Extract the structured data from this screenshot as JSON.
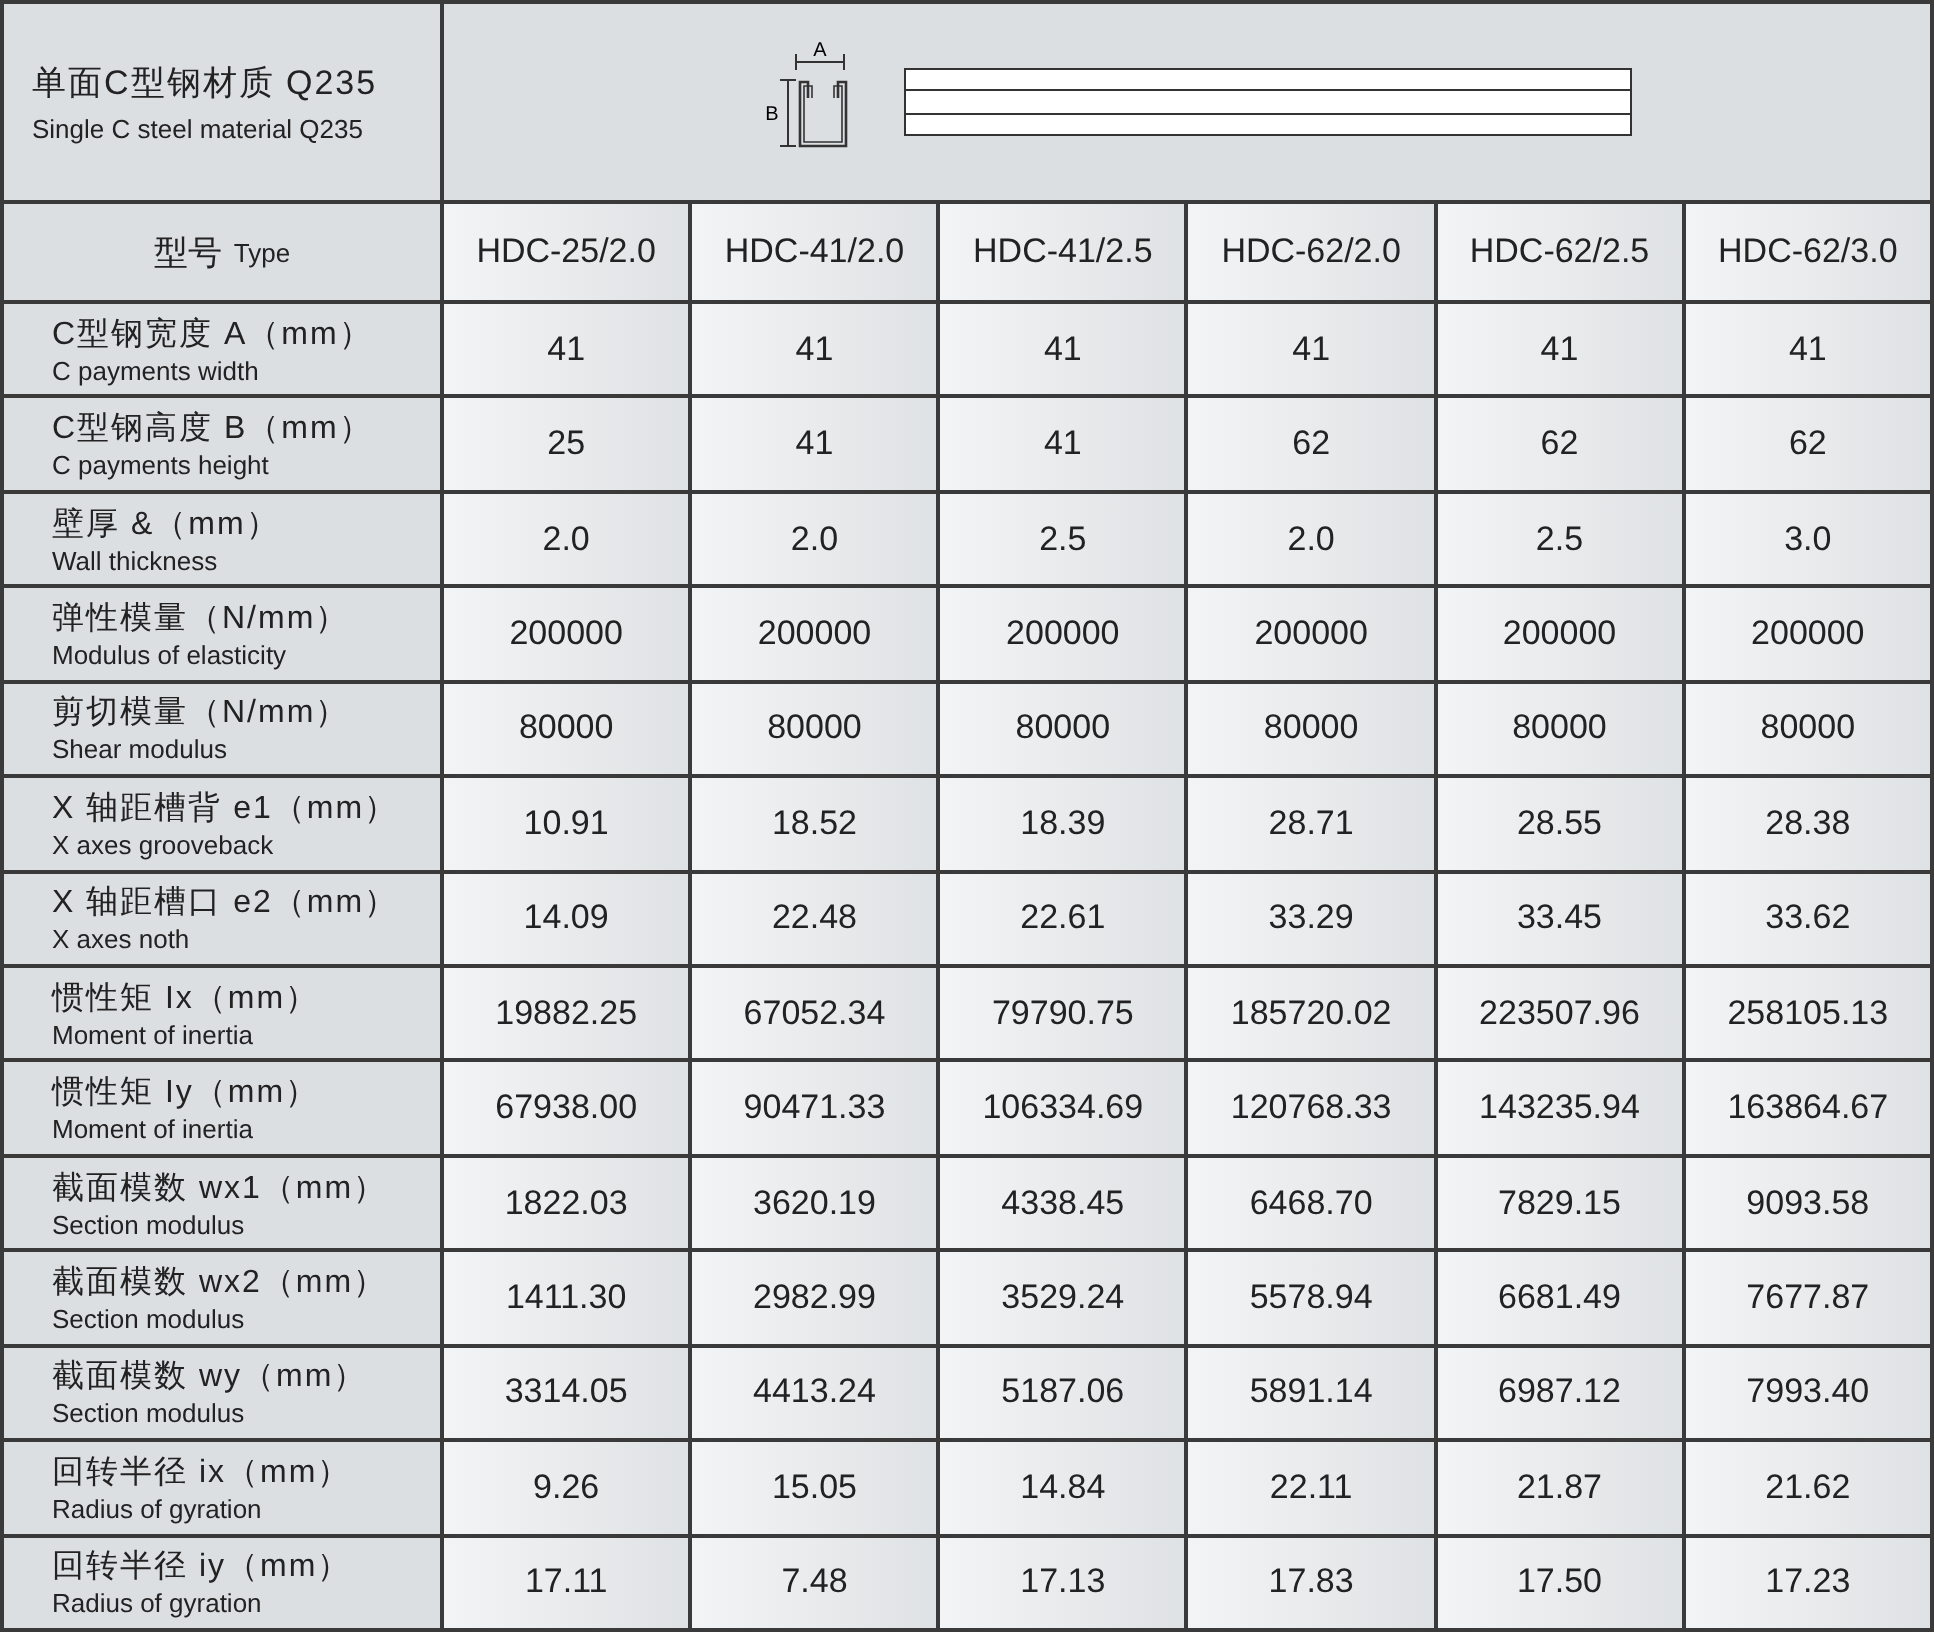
{
  "header": {
    "title_zh": "单面C型钢材质 Q235",
    "title_en": "Single C steel material Q235",
    "dimension_a": "A",
    "dimension_b": "B"
  },
  "type_row": {
    "label_zh": "型号",
    "label_en": "Type",
    "models": [
      "HDC-25/2.0",
      "HDC-41/2.0",
      "HDC-41/2.5",
      "HDC-62/2.0",
      "HDC-62/2.5",
      "HDC-62/3.0"
    ]
  },
  "rows": [
    {
      "label_zh": "C型钢宽度 A（mm）",
      "label_en": "C payments width",
      "values": [
        "41",
        "41",
        "41",
        "41",
        "41",
        "41"
      ]
    },
    {
      "label_zh": "C型钢高度 B（mm）",
      "label_en": "C payments height",
      "values": [
        "25",
        "41",
        "41",
        "62",
        "62",
        "62"
      ]
    },
    {
      "label_zh": "壁厚 &（mm）",
      "label_en": "Wall thickness",
      "values": [
        "2.0",
        "2.0",
        "2.5",
        "2.0",
        "2.5",
        "3.0"
      ]
    },
    {
      "label_zh": "弹性模量（N/mm）",
      "label_en": "Modulus of elasticity",
      "values": [
        "200000",
        "200000",
        "200000",
        "200000",
        "200000",
        "200000"
      ]
    },
    {
      "label_zh": "剪切模量（N/mm）",
      "label_en": "Shear modulus",
      "values": [
        "80000",
        "80000",
        "80000",
        "80000",
        "80000",
        "80000"
      ]
    },
    {
      "label_zh": "X 轴距槽背 e1（mm）",
      "label_en": "X axes grooveback",
      "values": [
        "10.91",
        "18.52",
        "18.39",
        "28.71",
        "28.55",
        "28.38"
      ]
    },
    {
      "label_zh": "X 轴距槽口 e2（mm）",
      "label_en": "X axes noth",
      "values": [
        "14.09",
        "22.48",
        "22.61",
        "33.29",
        "33.45",
        "33.62"
      ]
    },
    {
      "label_zh": "惯性矩 Ix（mm）",
      "label_en": "Moment of inertia",
      "values": [
        "19882.25",
        "67052.34",
        "79790.75",
        "185720.02",
        "223507.96",
        "258105.13"
      ]
    },
    {
      "label_zh": "惯性矩 Iy（mm）",
      "label_en": "Moment of inertia",
      "values": [
        "67938.00",
        "90471.33",
        "106334.69",
        "120768.33",
        "143235.94",
        "163864.67"
      ]
    },
    {
      "label_zh": "截面模数 wx1（mm）",
      "label_en": "Section modulus",
      "values": [
        "1822.03",
        "3620.19",
        "4338.45",
        "6468.70",
        "7829.15",
        "9093.58"
      ]
    },
    {
      "label_zh": "截面模数 wx2（mm）",
      "label_en": "Section modulus",
      "values": [
        "1411.30",
        "2982.99",
        "3529.24",
        "5578.94",
        "6681.49",
        "7677.87"
      ]
    },
    {
      "label_zh": "截面模数 wy（mm）",
      "label_en": "Section modulus",
      "values": [
        "3314.05",
        "4413.24",
        "5187.06",
        "5891.14",
        "6987.12",
        "7993.40"
      ]
    },
    {
      "label_zh": "回转半径 ix（mm）",
      "label_en": "Radius of gyration",
      "values": [
        "9.26",
        "15.05",
        "14.84",
        "22.11",
        "21.87",
        "21.62"
      ]
    },
    {
      "label_zh": "回转半径 iy（mm）",
      "label_en": "Radius of gyration",
      "values": [
        "17.11",
        "7.48",
        "17.13",
        "17.83",
        "17.50",
        "17.23"
      ]
    }
  ]
}
